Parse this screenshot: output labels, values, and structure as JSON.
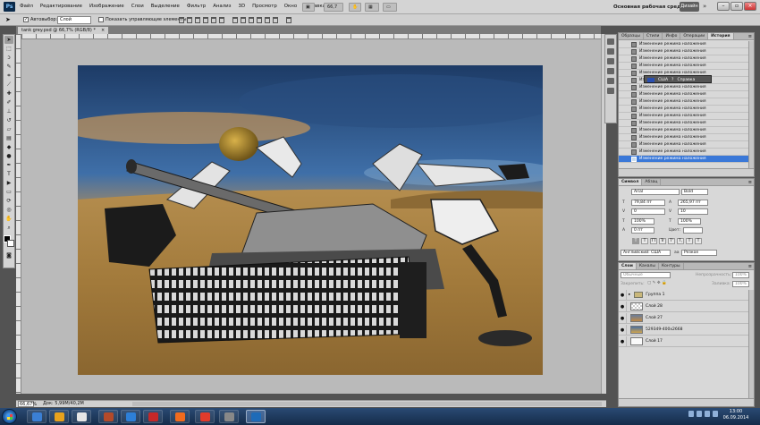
{
  "app": {
    "logo": "Ps"
  },
  "menu": [
    "Файл",
    "Редактирование",
    "Изображение",
    "Слои",
    "Выделение",
    "Фильтр",
    "Анализ",
    "3D",
    "Просмотр",
    "Окно",
    "Справка"
  ],
  "menubar": {
    "zoom_level": "66,7",
    "workspace": "Основная рабочая среда",
    "design_button": "Дизайн"
  },
  "options": {
    "autoselect_label": "Автовыбор:",
    "autoselect_value": "Слой",
    "show_controls_label": "Показать управляющие элементы"
  },
  "document": {
    "tab_title": "tank grey.psd @ 66,7% (RGB/8) *",
    "close": "×"
  },
  "status": {
    "zoom": "66,67%",
    "doc_size": "Док: 5,99M/40,2M"
  },
  "history": {
    "tabs": [
      "Образцы",
      "Стили",
      "Инфо",
      "Операции",
      "История"
    ],
    "active_tab": "История",
    "row_label": "Изменение режима наложения",
    "selected_index": 16
  },
  "layout_popup": {
    "lang": "США",
    "help": "Справка"
  },
  "character": {
    "tabs": [
      "Символ",
      "Абзац"
    ],
    "font_family": "Arial",
    "font_style": "Bold",
    "font_size": "79,84 пт",
    "leading": "265,97 пт",
    "kerning": "0",
    "tracking": "10",
    "v_scale": "100%",
    "h_scale": "100%",
    "baseline": "0 пт",
    "color_label": "Цвет:",
    "language": "Английский: США",
    "antialias_label": "aa",
    "antialias": "Резкое",
    "style_buttons": [
      "T",
      "T",
      "TT",
      "Tr",
      "T'",
      "T,",
      "T",
      "T"
    ]
  },
  "layers": {
    "tabs": [
      "Слои",
      "Каналы",
      "Контуры"
    ],
    "blend_mode": "Обычные",
    "opacity_label": "Непрозрачность:",
    "opacity": "100%",
    "lock_label": "Закрепить:",
    "fill_label": "Заливка:",
    "fill": "100%",
    "items": [
      {
        "name": "Группа 1",
        "kind": "folder"
      },
      {
        "name": "Слой 28",
        "kind": "checker"
      },
      {
        "name": "Слой 27",
        "kind": "photo1"
      },
      {
        "name": "529349-400x2668",
        "kind": "photo2"
      },
      {
        "name": "Слой 17",
        "kind": "white"
      }
    ]
  },
  "taskbar": {
    "clock_time": "13:00",
    "clock_date": "06.09.2014",
    "icon_colors": [
      "#3b7fd4",
      "#e8a21c",
      "#e5e5e5",
      "#b34a2a",
      "#2d7fd7",
      "#c62828",
      "#f26b1d",
      "#e23b2b",
      "#888888",
      "#1e6bb8"
    ]
  }
}
